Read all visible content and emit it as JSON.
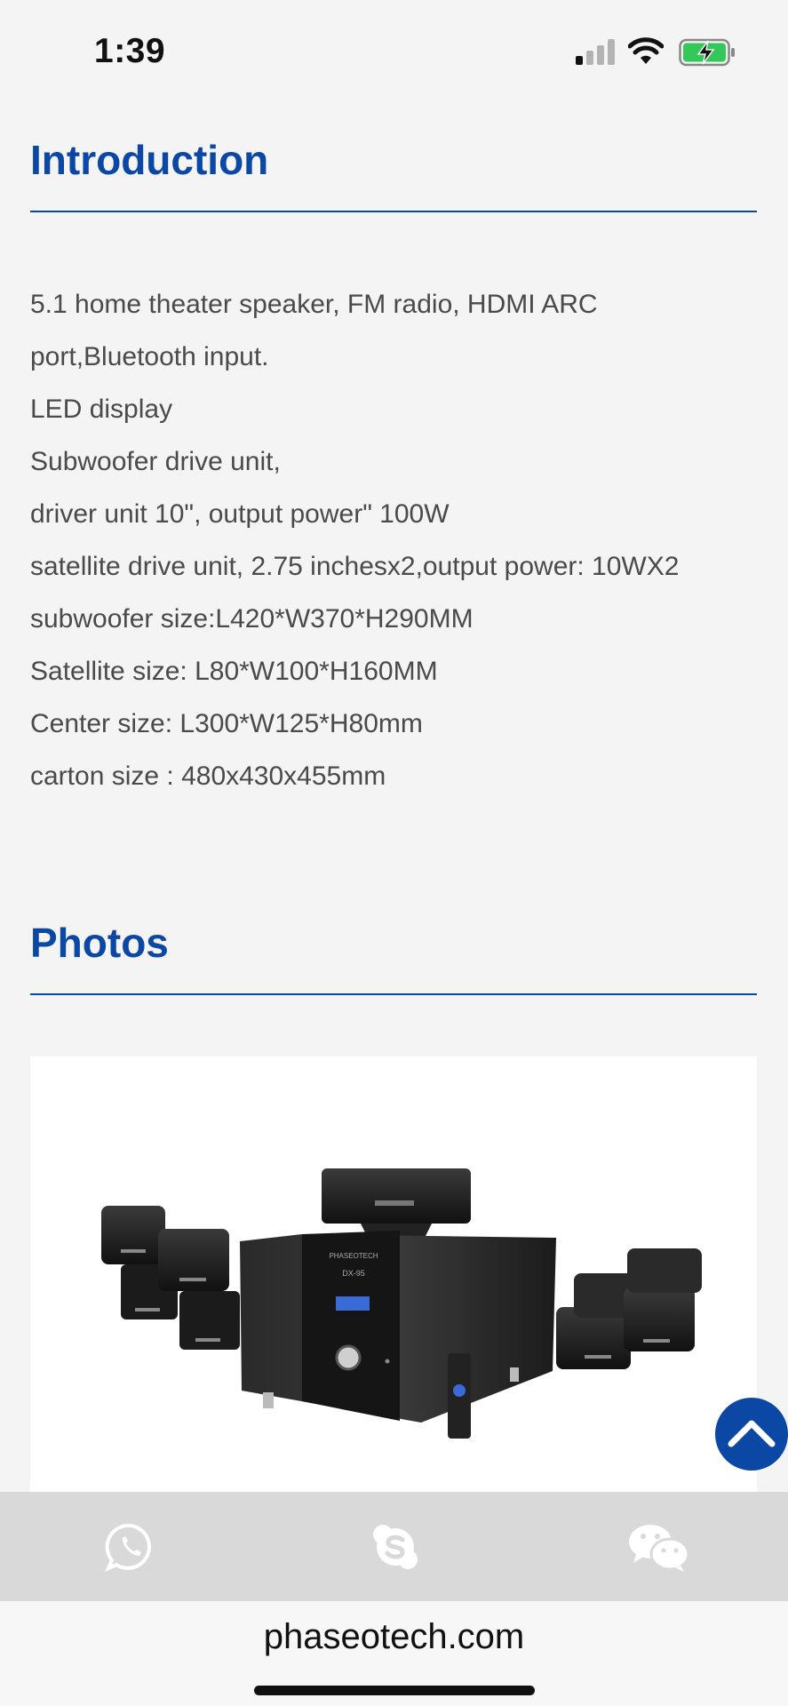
{
  "status_bar": {
    "time": "1:39",
    "signal_icon": "cellular-signal-icon",
    "wifi_icon": "wifi-icon",
    "battery_icon": "battery-charging-icon",
    "battery_color": "#34c759"
  },
  "introduction": {
    "title": "Introduction",
    "lines": [
      "5.1 home theater speaker, FM radio, HDMI ARC",
      "port,Bluetooth input.",
      "LED display",
      "Subwoofer drive unit,",
      "driver unit 10\", output power\" 100W",
      "satellite drive unit, 2.75 inchesx2,output power: 10WX2",
      "subwoofer size:L420*W370*H290MM",
      "Satellite size: L80*W100*H160MM",
      "Center size: L300*W125*H80mm",
      "carton size : 480x430x455mm"
    ]
  },
  "photos": {
    "title": "Photos",
    "image_icon": "home-theater-speaker-system-photo",
    "display_text": "DX-95",
    "brand_text": "PHASEOTECH"
  },
  "scroll_top": {
    "icon": "chevron-up-icon"
  },
  "bottom_bar": {
    "items": [
      {
        "icon": "whatsapp-icon"
      },
      {
        "icon": "skype-icon"
      },
      {
        "icon": "wechat-icon"
      }
    ]
  },
  "browser": {
    "url": "phaseotech.com"
  },
  "colors": {
    "accent": "#0b47a4",
    "text": "#4a4a4a",
    "background": "#f4f4f4",
    "bottom_bar": "#d9d9d9"
  }
}
